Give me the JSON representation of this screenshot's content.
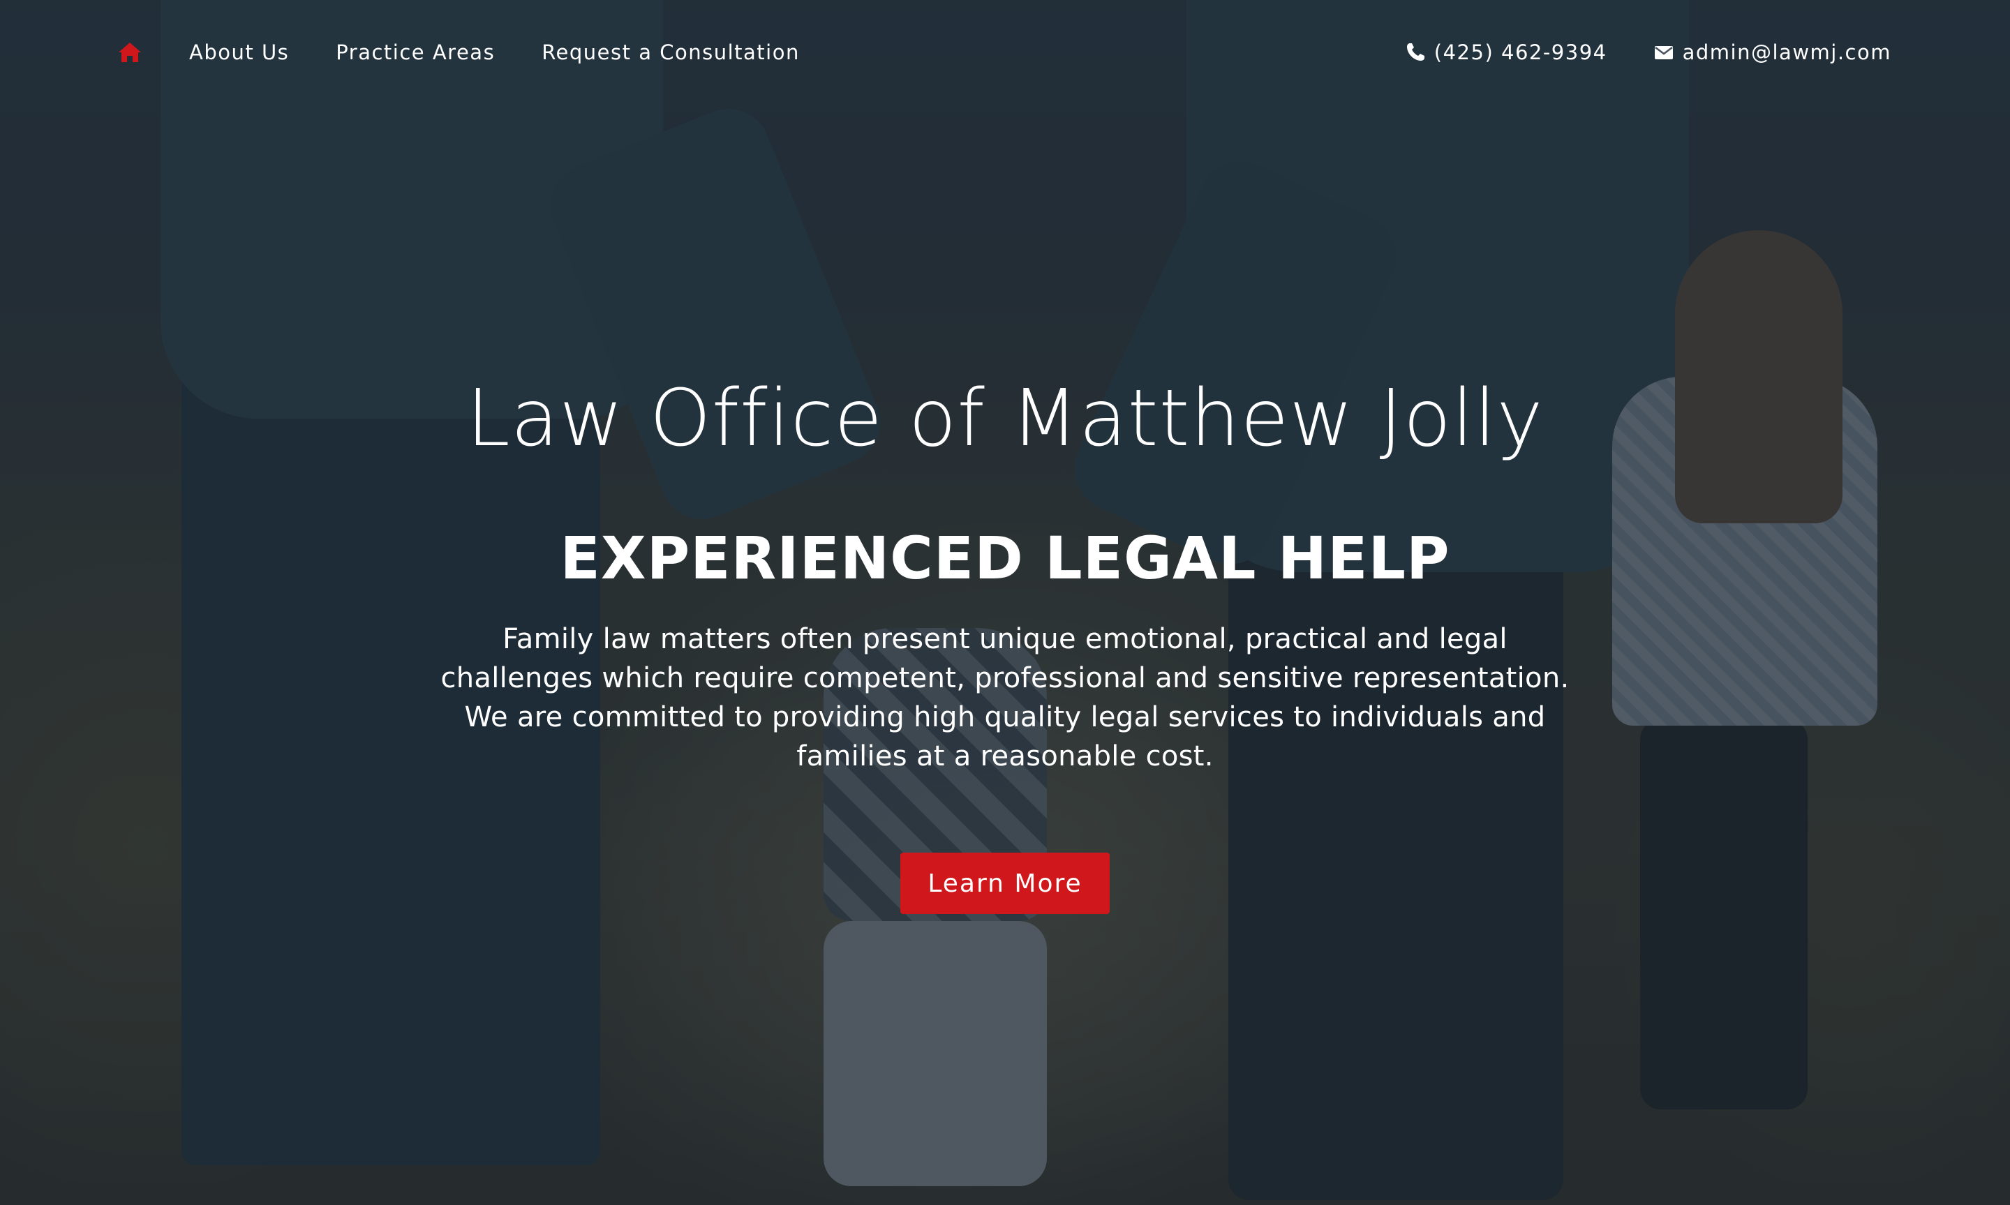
{
  "nav": {
    "home_label": "Home",
    "links": [
      {
        "label": "About Us"
      },
      {
        "label": "Practice Areas"
      },
      {
        "label": "Request a Consultation"
      }
    ],
    "phone": "(425) 462-9394",
    "email": "admin@lawmj.com"
  },
  "hero": {
    "title": "Law Office of Matthew Jolly",
    "tagline": "EXPERIENCED LEGAL HELP",
    "description": "Family law matters often present unique emotional, practical and legal challenges which require competent, professional and sensitive representation. We are committed to providing high quality legal services to individuals and families at a reasonable cost.",
    "cta_label": "Learn More"
  },
  "colors": {
    "accent": "#d0171c",
    "overlay": "#1c2630",
    "text": "#ffffff"
  },
  "icons": {
    "home": "home-icon",
    "phone": "phone-icon",
    "email": "envelope-icon"
  }
}
